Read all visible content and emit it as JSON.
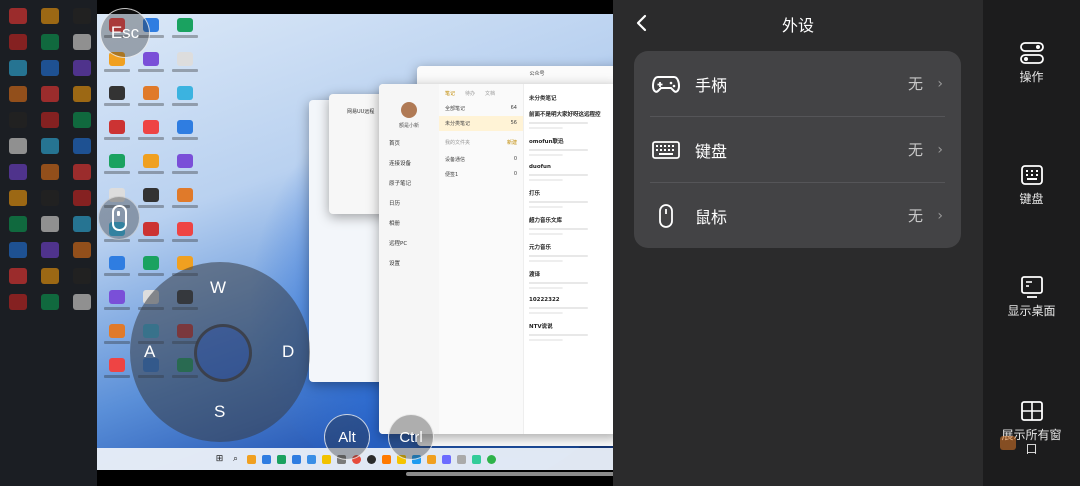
{
  "overlay_keys": {
    "esc": "Esc",
    "alt": "Alt",
    "ctrl": "Ctrl",
    "w": "W",
    "a": "A",
    "s": "S",
    "d": "D"
  },
  "peripherals_panel": {
    "title": "外设",
    "rows": [
      {
        "label": "手柄",
        "value": "无",
        "icon": "gamepad-icon"
      },
      {
        "label": "键盘",
        "value": "无",
        "icon": "keyboard-icon"
      },
      {
        "label": "鼠标",
        "value": "无",
        "icon": "mouse-icon"
      }
    ]
  },
  "toolbar": {
    "items": [
      {
        "label": "操作",
        "icon": "toggle-icon"
      },
      {
        "label": "键盘",
        "icon": "keyboard-icon"
      },
      {
        "label": "显示桌面",
        "icon": "desktop-icon"
      },
      {
        "label": "展示所有窗口",
        "icon": "windows-grid-icon"
      }
    ]
  },
  "notes_app": {
    "user_name": "额是小新",
    "nav": [
      "首页",
      "连接设备",
      "原子笔记",
      "日历",
      "相册",
      "远程PC",
      "设置"
    ],
    "tabs": [
      "笔记",
      "待办",
      "文档"
    ],
    "folders": [
      {
        "name": "全部笔记",
        "count": "64"
      },
      {
        "name": "未分类笔记",
        "count": "56"
      }
    ],
    "folders_header": "我的文件夹",
    "folders_action": "新建",
    "sub_folders": [
      {
        "name": "设备通信",
        "count": "0"
      },
      {
        "name": "便签1",
        "count": "0"
      }
    ],
    "notes_title": "未分类笔记",
    "notes": [
      {
        "title": "前面不是明大家好呀这远程控"
      },
      {
        "title": "omofun联迅"
      },
      {
        "title": "duofun"
      },
      {
        "title": "打乐"
      },
      {
        "title": "超力音乐文库"
      },
      {
        "title": "元力音乐"
      },
      {
        "title": "渡译"
      },
      {
        "title": "10222322"
      },
      {
        "title": "NTV说说"
      }
    ],
    "window_title_b": "网易UU远程",
    "window_title_c": "公众号"
  },
  "colors": {
    "panel_bg": "#2b2b2c",
    "card_bg": "#434345",
    "toolbar_bg": "#1c1c1d"
  }
}
